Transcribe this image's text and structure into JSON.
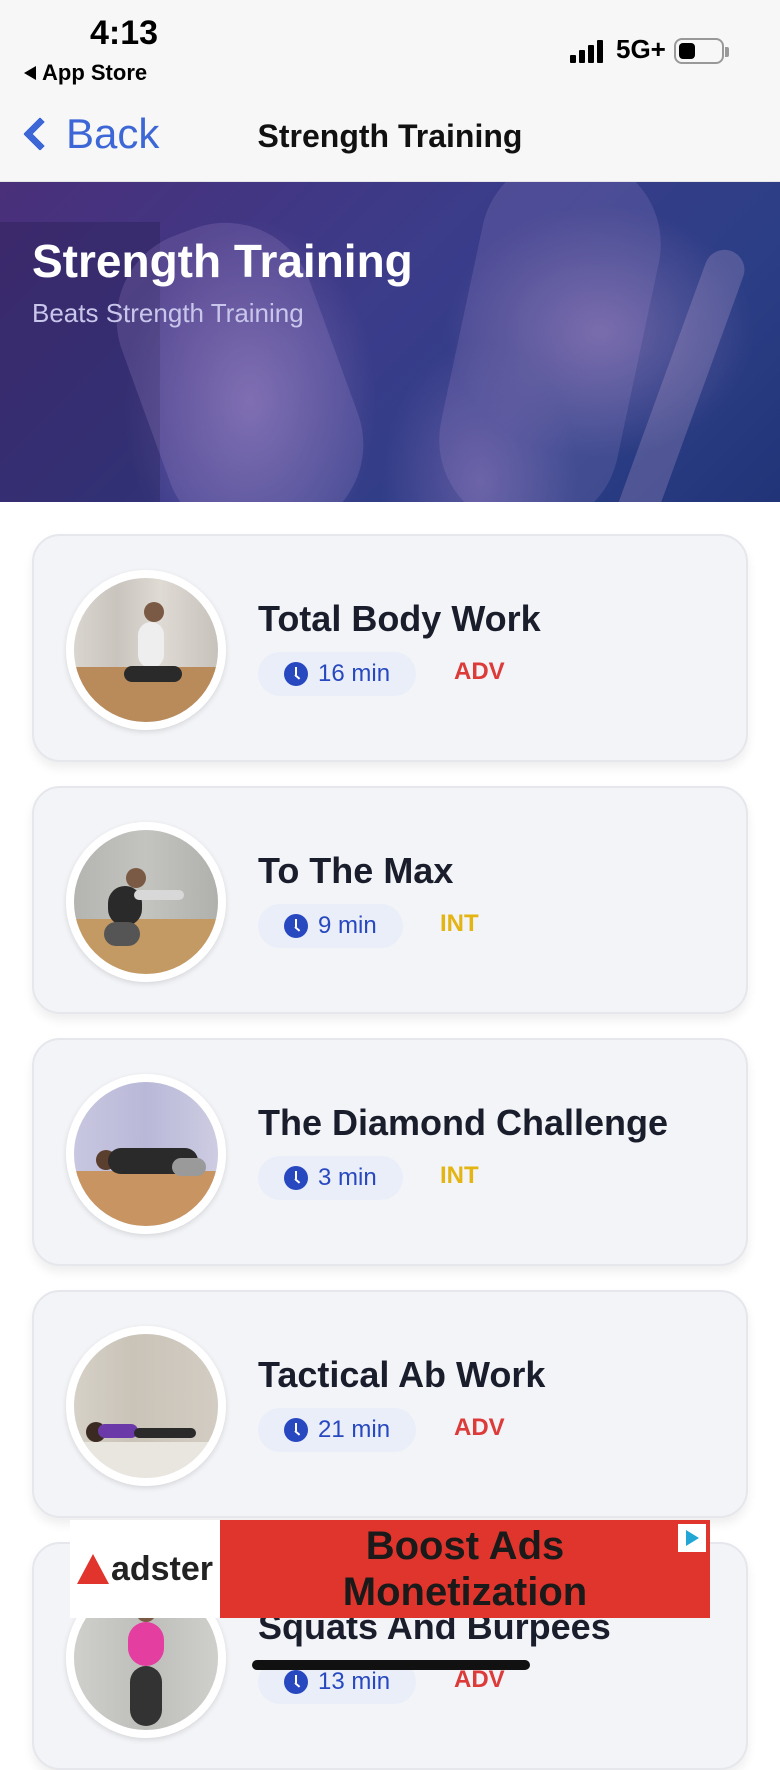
{
  "status_bar": {
    "time": "4:13",
    "back_app": "App Store",
    "network": "5G+"
  },
  "nav": {
    "back_label": "Back",
    "title": "Strength Training"
  },
  "hero": {
    "title": "Strength Training",
    "subtitle": "Beats Strength Training"
  },
  "workouts": [
    {
      "title": "Total Body Work",
      "duration": "16 min",
      "level": "ADV",
      "level_color": "#dd3a3a"
    },
    {
      "title": "To The Max",
      "duration": "9 min",
      "level": "INT",
      "level_color": "#e3b412"
    },
    {
      "title": "The Diamond Challenge",
      "duration": "3 min",
      "level": "INT",
      "level_color": "#e3b412"
    },
    {
      "title": "Tactical Ab Work",
      "duration": "21 min",
      "level": "ADV",
      "level_color": "#dd3a3a"
    },
    {
      "title": "Squats And Burpees",
      "duration": "13 min",
      "level": "ADV",
      "level_color": "#dd3a3a"
    }
  ],
  "ad": {
    "brand": "adster",
    "line1": "Boost Ads",
    "line2": "Monetization"
  },
  "colors": {
    "accent": "#3d66d6",
    "clock": "#2848c0",
    "adv": "#dd3a3a",
    "int": "#e3b412"
  }
}
